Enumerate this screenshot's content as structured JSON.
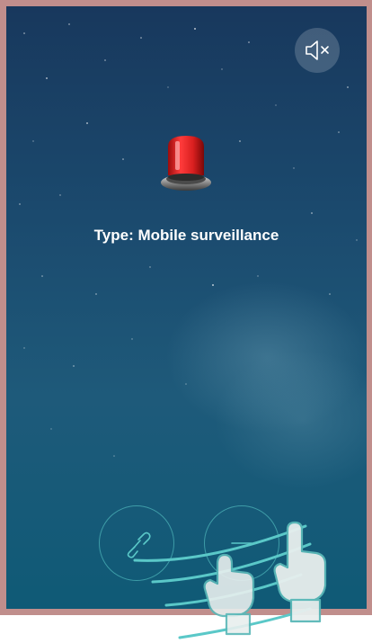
{
  "alarm": {
    "type_text": "Type: Mobile surveillance"
  },
  "icons": {
    "mute": "speaker-muted-icon",
    "siren": "siren-icon",
    "link": "link-icon",
    "hangup": "hangup-icon",
    "gesture": "swipe-hand-icon"
  },
  "colors": {
    "background_top": "#18385d",
    "background_bottom": "#0f5a76",
    "accent": "#5ac8c8",
    "siren_red": "#d81f1f",
    "border": "#c08e8c"
  }
}
